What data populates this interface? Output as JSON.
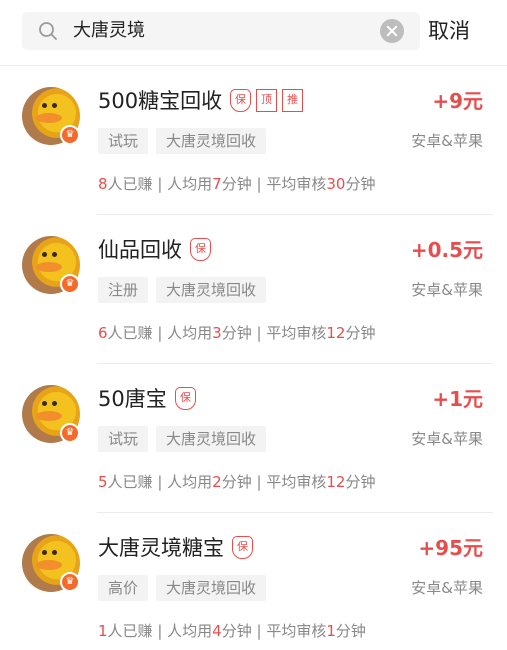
{
  "search": {
    "query": "大唐灵境",
    "cancel_label": "取消"
  },
  "colors": {
    "accent": "#e64e4e",
    "tag_bg": "#f3f3f3",
    "muted": "#888888"
  },
  "items": [
    {
      "title": "500糖宝回收",
      "badges": [
        "保",
        "顶",
        "推"
      ],
      "price": "+9元",
      "tags": [
        "试玩",
        "大唐灵境回收"
      ],
      "platform": "安卓&苹果",
      "stats": {
        "earned_num": "8",
        "earned_suffix": "人已赚",
        "avg_prefix": "人均用",
        "avg_num": "7",
        "avg_suffix": "分钟",
        "review_prefix": "平均审核",
        "review_num": "30",
        "review_suffix": "分钟",
        "sep": " | "
      }
    },
    {
      "title": "仙品回收",
      "badges": [
        "保"
      ],
      "price": "+0.5元",
      "tags": [
        "注册",
        "大唐灵境回收"
      ],
      "platform": "安卓&苹果",
      "stats": {
        "earned_num": "6",
        "earned_suffix": "人已赚",
        "avg_prefix": "人均用",
        "avg_num": "3",
        "avg_suffix": "分钟",
        "review_prefix": "平均审核",
        "review_num": "12",
        "review_suffix": "分钟",
        "sep": " | "
      }
    },
    {
      "title": "50唐宝",
      "badges": [
        "保"
      ],
      "price": "+1元",
      "tags": [
        "试玩",
        "大唐灵境回收"
      ],
      "platform": "安卓&苹果",
      "stats": {
        "earned_num": "5",
        "earned_suffix": "人已赚",
        "avg_prefix": "人均用",
        "avg_num": "2",
        "avg_suffix": "分钟",
        "review_prefix": "平均审核",
        "review_num": "12",
        "review_suffix": "分钟",
        "sep": " | "
      }
    },
    {
      "title": "大唐灵境糖宝",
      "badges": [
        "保"
      ],
      "price": "+95元",
      "tags": [
        "高价",
        "大唐灵境回收"
      ],
      "platform": "安卓&苹果",
      "stats": {
        "earned_num": "1",
        "earned_suffix": "人已赚",
        "avg_prefix": "人均用",
        "avg_num": "4",
        "avg_suffix": "分钟",
        "review_prefix": "平均审核",
        "review_num": "1",
        "review_suffix": "分钟",
        "sep": " | "
      }
    }
  ]
}
